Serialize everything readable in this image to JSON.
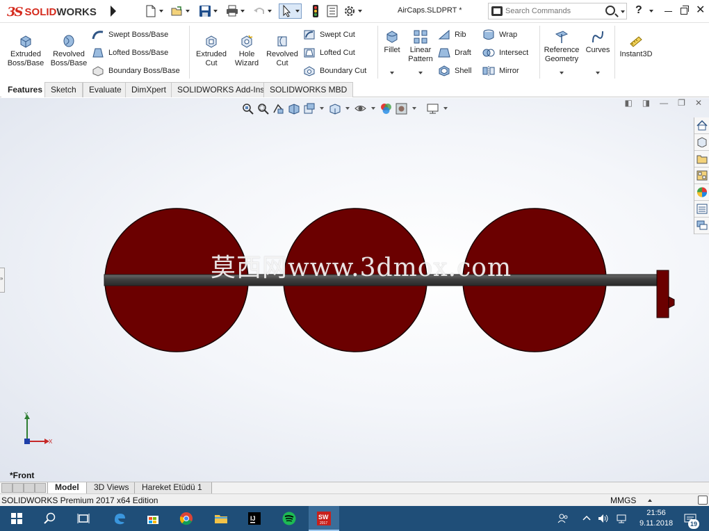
{
  "app": {
    "logo_ds": "3S",
    "logo_solid": "SOLID",
    "logo_works": "WORKS",
    "document_title": "AirCaps.SLDPRT *"
  },
  "search": {
    "placeholder": "Search Commands"
  },
  "help_label": "?",
  "ribbon": {
    "extruded_boss": "Extruded\nBoss/Base",
    "revolved_boss": "Revolved\nBoss/Base",
    "swept_boss": "Swept Boss/Base",
    "lofted_boss": "Lofted Boss/Base",
    "boundary_boss": "Boundary Boss/Base",
    "extruded_cut": "Extruded\nCut",
    "hole_wizard": "Hole\nWizard",
    "revolved_cut": "Revolved\nCut",
    "swept_cut": "Swept Cut",
    "lofted_cut": "Lofted Cut",
    "boundary_cut": "Boundary Cut",
    "fillet": "Fillet",
    "linear_pattern": "Linear\nPattern",
    "rib": "Rib",
    "draft": "Draft",
    "shell": "Shell",
    "wrap": "Wrap",
    "intersect": "Intersect",
    "mirror": "Mirror",
    "reference_geometry": "Reference\nGeometry",
    "curves": "Curves",
    "instant3d": "Instant3D"
  },
  "tabs": [
    "Features",
    "Sketch",
    "Evaluate",
    "DimXpert",
    "SOLIDWORKS Add-Ins",
    "SOLIDWORKS MBD"
  ],
  "viewport": {
    "watermark": "莫西网www.3dmox.com",
    "view_name": "*Front",
    "triad_x": "X",
    "triad_y": "Y"
  },
  "bottom_tabs": [
    "Model",
    "3D Views",
    "Hareket Etüdü 1"
  ],
  "status": {
    "edition": "SOLIDWORKS Premium 2017 x64 Edition",
    "units": "MMGS"
  },
  "taskbar": {
    "time": "21:56",
    "date": "9.11.2018",
    "notifications": "19",
    "sw_badge": "SW",
    "sw_year": "2017",
    "intellij_label": "IJ"
  },
  "colors": {
    "cap_fill": "#6b0000",
    "axle": "#4a4a4a",
    "taskbar": "#1f4e78",
    "brand_red": "#d52b1e"
  }
}
